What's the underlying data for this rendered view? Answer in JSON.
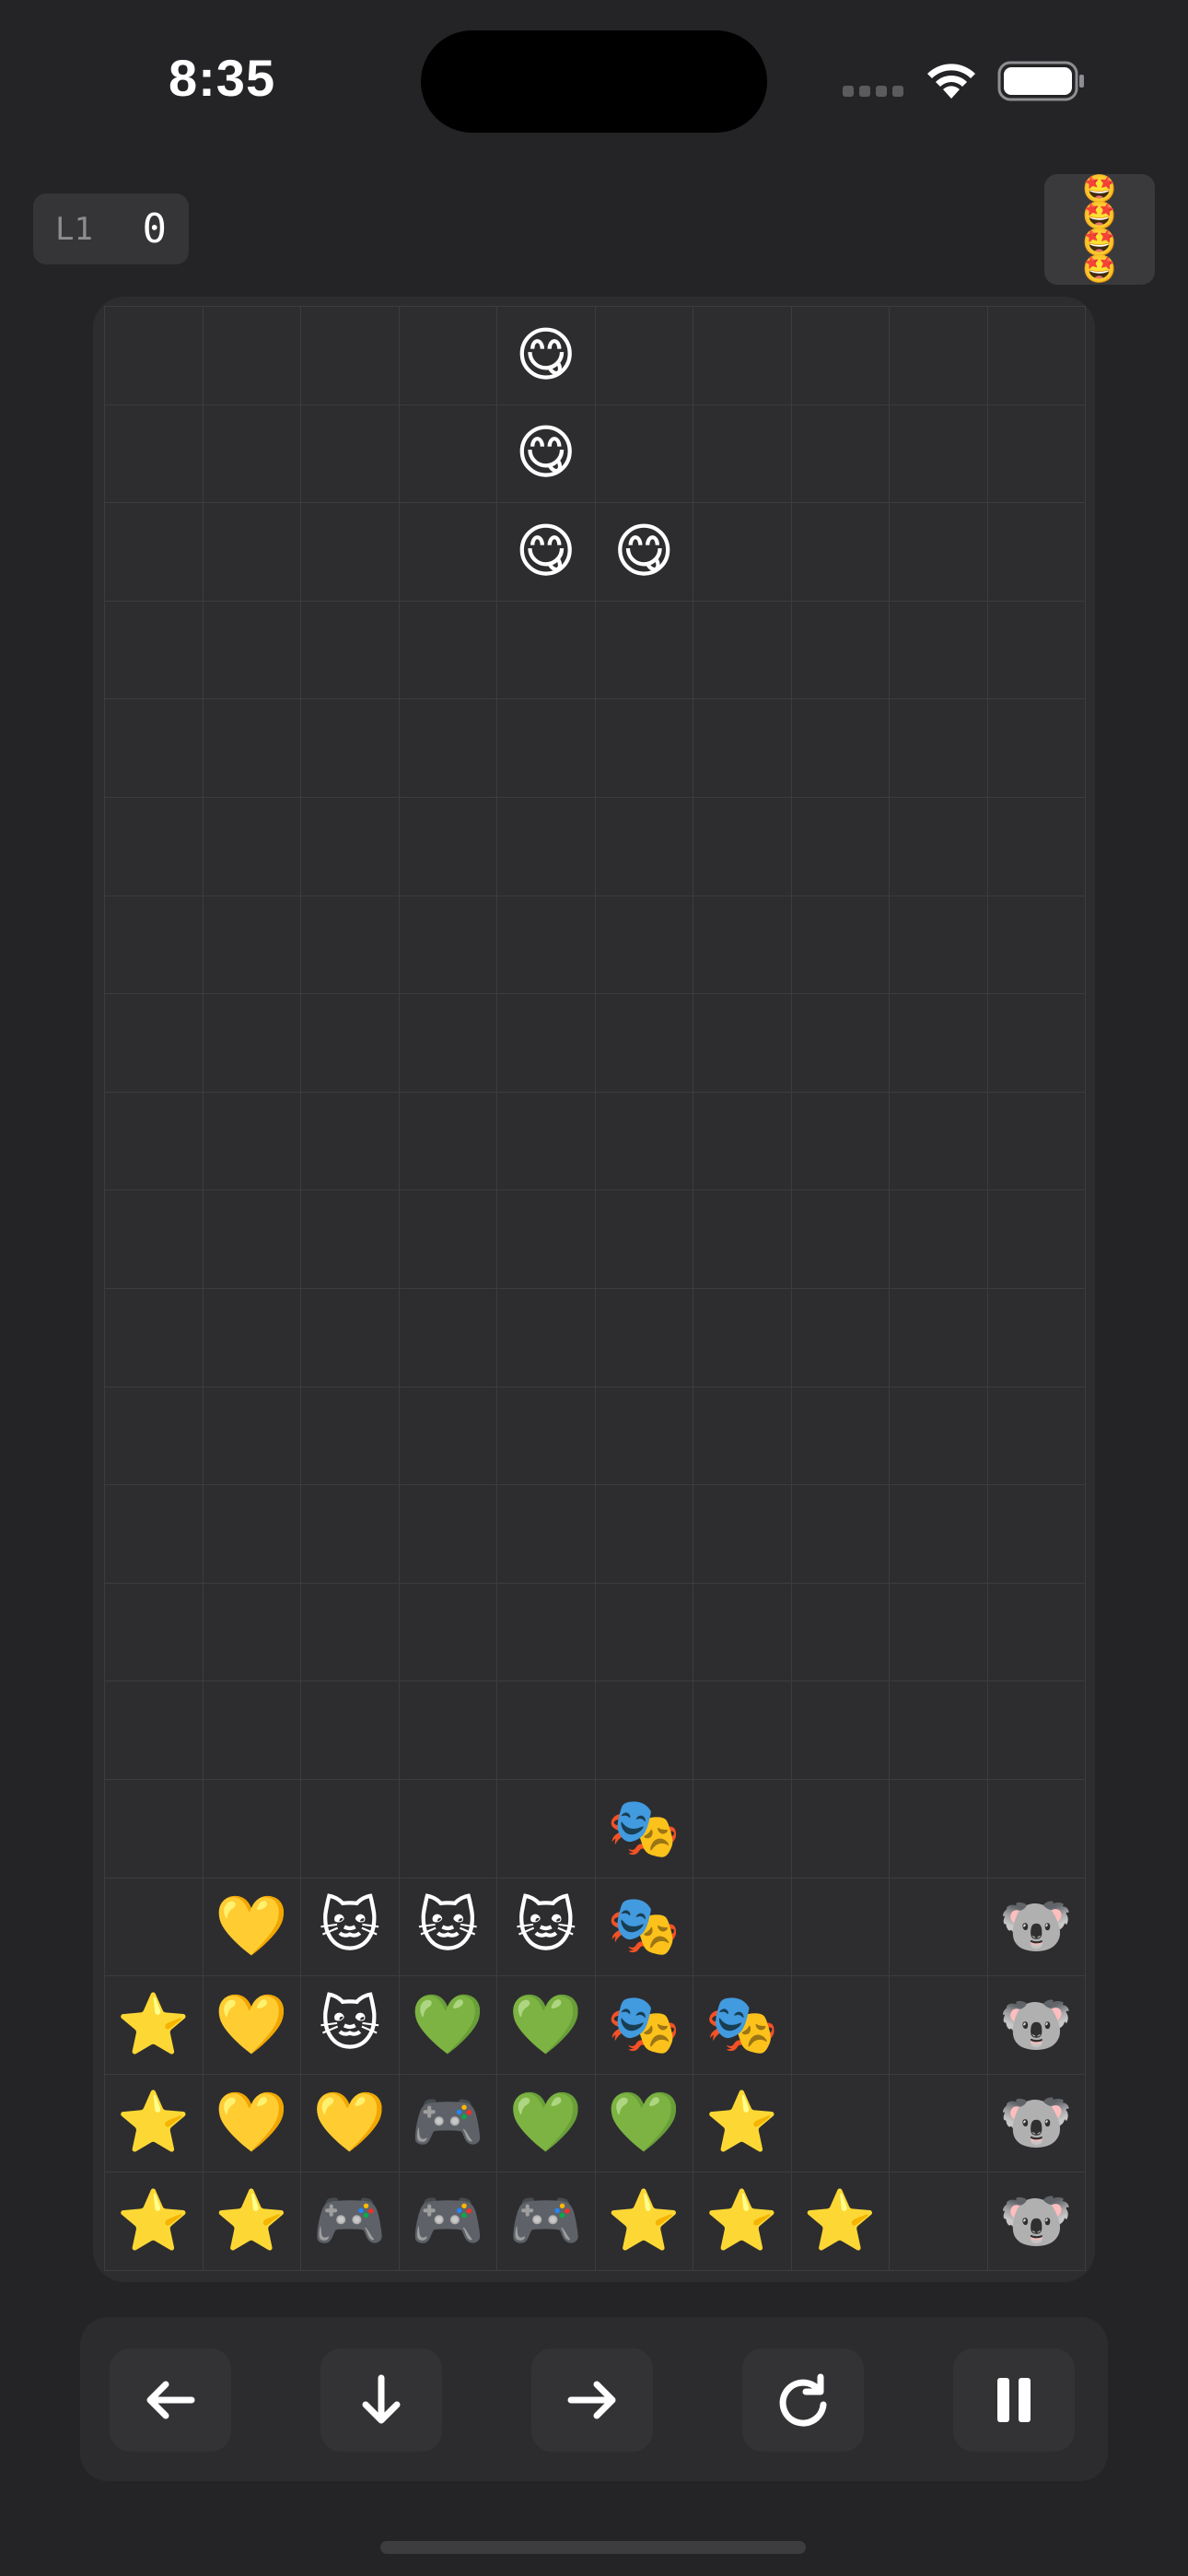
{
  "status_bar": {
    "time": "8:35"
  },
  "hud": {
    "level_label": "L1",
    "score": "0",
    "next_piece_emoji": "🤩"
  },
  "board": {
    "rows": [
      [
        "",
        "",
        "",
        "",
        "😋",
        "",
        "",
        "",
        "",
        ""
      ],
      [
        "",
        "",
        "",
        "",
        "😋",
        "",
        "",
        "",
        "",
        ""
      ],
      [
        "",
        "",
        "",
        "",
        "😋",
        "😋",
        "",
        "",
        "",
        ""
      ],
      [
        "",
        "",
        "",
        "",
        "",
        "",
        "",
        "",
        "",
        ""
      ],
      [
        "",
        "",
        "",
        "",
        "",
        "",
        "",
        "",
        "",
        ""
      ],
      [
        "",
        "",
        "",
        "",
        "",
        "",
        "",
        "",
        "",
        ""
      ],
      [
        "",
        "",
        "",
        "",
        "",
        "",
        "",
        "",
        "",
        ""
      ],
      [
        "",
        "",
        "",
        "",
        "",
        "",
        "",
        "",
        "",
        ""
      ],
      [
        "",
        "",
        "",
        "",
        "",
        "",
        "",
        "",
        "",
        ""
      ],
      [
        "",
        "",
        "",
        "",
        "",
        "",
        "",
        "",
        "",
        ""
      ],
      [
        "",
        "",
        "",
        "",
        "",
        "",
        "",
        "",
        "",
        ""
      ],
      [
        "",
        "",
        "",
        "",
        "",
        "",
        "",
        "",
        "",
        ""
      ],
      [
        "",
        "",
        "",
        "",
        "",
        "",
        "",
        "",
        "",
        ""
      ],
      [
        "",
        "",
        "",
        "",
        "",
        "",
        "",
        "",
        "",
        ""
      ],
      [
        "",
        "",
        "",
        "",
        "",
        "",
        "",
        "",
        "",
        ""
      ],
      [
        "",
        "",
        "",
        "",
        "",
        "🎭",
        "",
        "",
        "",
        ""
      ],
      [
        "",
        "💛",
        "🐱",
        "🐱",
        "🐱",
        "🎭",
        "",
        "",
        "",
        "🐨"
      ],
      [
        "⭐",
        "💛",
        "🐱",
        "💚",
        "💚",
        "🎭",
        "🎭",
        "",
        "",
        "🐨"
      ],
      [
        "⭐",
        "💛",
        "💛",
        "🎮",
        "💚",
        "💚",
        "⭐",
        "",
        "",
        "🐨"
      ],
      [
        "⭐",
        "⭐",
        "🎮",
        "🎮",
        "🎮",
        "⭐",
        "⭐",
        "⭐",
        "",
        "🐨"
      ]
    ]
  },
  "controls": [
    {
      "name": "move-left-button",
      "icon": "arrow-left-icon"
    },
    {
      "name": "soft-drop-button",
      "icon": "arrow-down-icon"
    },
    {
      "name": "move-right-button",
      "icon": "arrow-right-icon"
    },
    {
      "name": "rotate-button",
      "icon": "rotate-clockwise-icon"
    },
    {
      "name": "pause-button",
      "icon": "pause-icon"
    }
  ],
  "colors": {
    "background": "#242426",
    "board": "#2d2d2f",
    "grid_line": "#3c3c3f",
    "control_bar": "#2c2c2e",
    "control_button": "#333335"
  }
}
